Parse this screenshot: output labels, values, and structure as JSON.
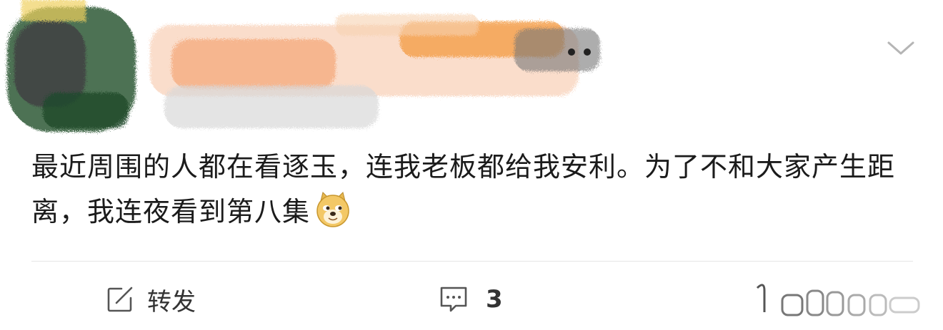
{
  "header": {
    "user_info": "",
    "menu_icon": "chevron-down-icon"
  },
  "post": {
    "text": "最近周围的人都在看逐玉，连我老板都给我安利。为了不和大家产生距离，我连夜看到第八集",
    "emoji": "doge-emoji"
  },
  "actions": {
    "repost_label": "转发",
    "repost_icon": "share-icon",
    "comment_count": "3",
    "comment_icon": "comment-icon",
    "like_icon": "like-icon"
  },
  "colors": {
    "text": "#1b1b1b",
    "divider": "#e6e6e6",
    "icon": "#555555"
  }
}
